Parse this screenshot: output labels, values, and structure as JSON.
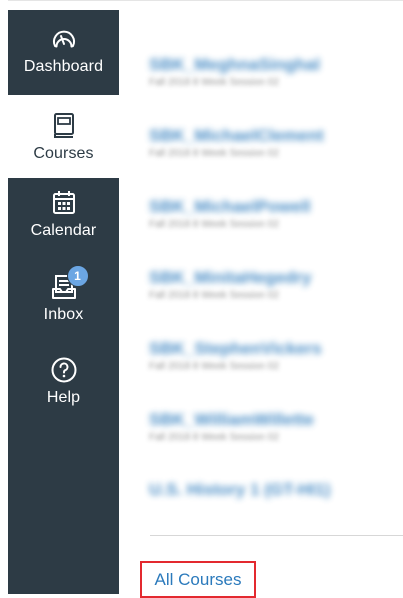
{
  "nav": {
    "dashboard": "Dashboard",
    "courses": "Courses",
    "calendar": "Calendar",
    "inbox": "Inbox",
    "inbox_badge": "1",
    "help": "Help"
  },
  "courses": [
    {
      "name": "SBK_MeghnaSinghal",
      "term": "Fall 2018 8 Week Session 02"
    },
    {
      "name": "SBK_MichaelClement",
      "term": "Fall 2018 8 Week Session 02"
    },
    {
      "name": "SBK_MichaelPowell",
      "term": "Fall 2018 8 Week Session 02"
    },
    {
      "name": "SBK_MinitaHegedry",
      "term": "Fall 2018 8 Week Session 02"
    },
    {
      "name": "SBK_StephenVickers",
      "term": "Fall 2018 8 Week Session 02"
    },
    {
      "name": "SBK_WilliamWillette",
      "term": "Fall 2018 8 Week Session 02"
    },
    {
      "name": "U.S. History 1 (GT-HI1)",
      "term": ""
    }
  ],
  "all_courses_label": "All Courses",
  "colors": {
    "sidebar_bg": "#2d3b45",
    "link": "#2b7abc",
    "badge": "#6ba6e3",
    "highlight_border": "#e3292f"
  }
}
